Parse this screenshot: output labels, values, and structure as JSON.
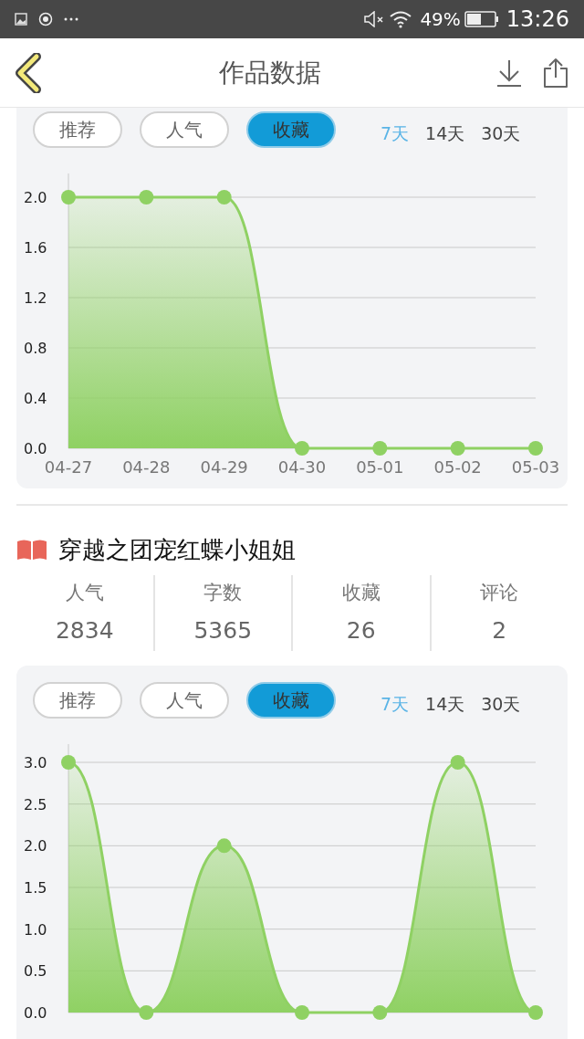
{
  "status_bar": {
    "battery_percent": "49%",
    "time": "13:26"
  },
  "header": {
    "title": "作品数据"
  },
  "sections": [
    {
      "chart_card": {
        "metric_tabs": [
          {
            "label": "推荐",
            "selected": false
          },
          {
            "label": "人气",
            "selected": false
          },
          {
            "label": "收藏",
            "selected": true
          }
        ],
        "range_tabs": [
          {
            "label": "7天",
            "selected": true
          },
          {
            "label": "14天",
            "selected": false
          },
          {
            "label": "30天",
            "selected": false
          }
        ],
        "chart_data": {
          "type": "area",
          "categories": [
            "04-27",
            "04-28",
            "04-29",
            "04-30",
            "05-01",
            "05-02",
            "05-03"
          ],
          "grid": true,
          "series": [
            {
              "color": "#8fd163",
              "values": [
                2,
                2,
                2,
                0,
                0,
                0,
                0
              ]
            }
          ],
          "ylim": [
            0,
            2
          ],
          "yticks": [
            {
              "value": 0,
              "label": "0.0"
            },
            {
              "value": 0.4,
              "label": "0.4"
            },
            {
              "value": 0.8,
              "label": "0.8"
            },
            {
              "value": 1.2,
              "label": "1.2"
            },
            {
              "value": 1.6,
              "label": "1.6"
            },
            {
              "value": 2,
              "label": "2.0"
            }
          ]
        }
      }
    },
    {
      "title": "穿越之团宠红蝶小姐姐",
      "stats": [
        {
          "label": "人气",
          "value": "2834"
        },
        {
          "label": "字数",
          "value": "5365"
        },
        {
          "label": "收藏",
          "value": "26"
        },
        {
          "label": "评论",
          "value": "2"
        }
      ],
      "chart_card": {
        "metric_tabs": [
          {
            "label": "推荐",
            "selected": false
          },
          {
            "label": "人气",
            "selected": false
          },
          {
            "label": "收藏",
            "selected": true
          }
        ],
        "range_tabs": [
          {
            "label": "7天",
            "selected": true
          },
          {
            "label": "14天",
            "selected": false
          },
          {
            "label": "30天",
            "selected": false
          }
        ],
        "chart_data": {
          "type": "area",
          "grid": true,
          "series": [
            {
              "color": "#8fd163",
              "values": [
                3,
                0,
                2,
                0,
                0,
                3,
                0
              ]
            }
          ],
          "ylim": [
            0,
            3
          ],
          "yticks": [
            {
              "value": 0,
              "label": "0.0"
            },
            {
              "value": 0.5,
              "label": "0.5"
            },
            {
              "value": 1,
              "label": "1.0"
            },
            {
              "value": 1.5,
              "label": "1.5"
            },
            {
              "value": 2,
              "label": "2.0"
            },
            {
              "value": 2.5,
              "label": "2.5"
            },
            {
              "value": 3,
              "label": "3.0"
            }
          ]
        }
      }
    }
  ]
}
